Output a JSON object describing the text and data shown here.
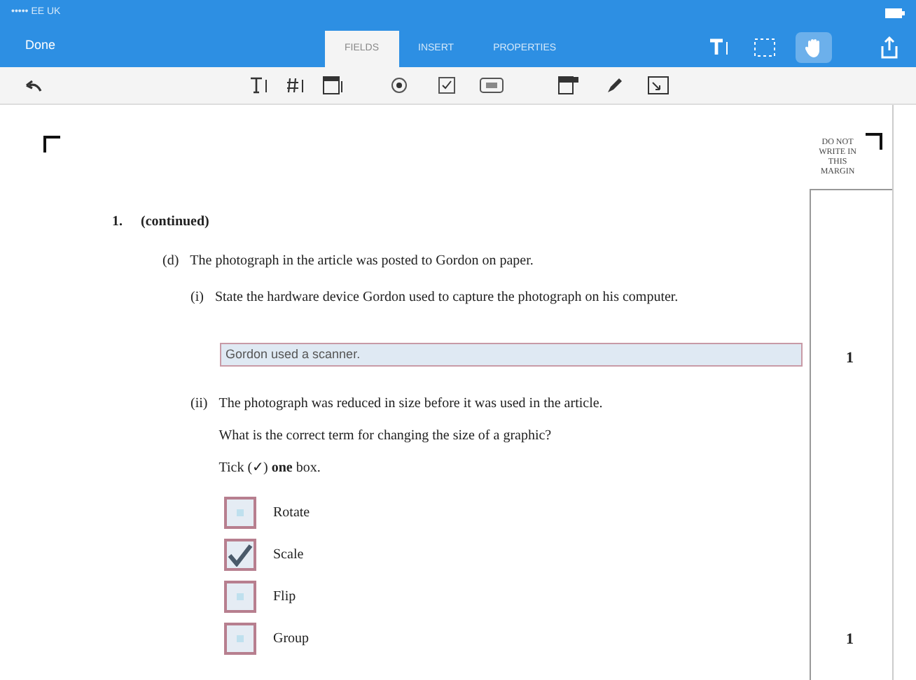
{
  "status_bar": {
    "carrier": "••••• EE UK"
  },
  "nav": {
    "done": "Done",
    "tabs": [
      {
        "label": "FIELDS",
        "selected": true
      },
      {
        "label": "INSERT",
        "selected": false
      },
      {
        "label": "PROPERTIES",
        "selected": false
      }
    ],
    "hand_tool": {
      "selected": true
    }
  },
  "document": {
    "margin_note": "DO NOT WRITE IN THIS MARGIN",
    "question_number": "1.",
    "heading": "(continued)",
    "part": {
      "label": "(d)",
      "text": "The photograph in the article was posted to Gordon on paper."
    },
    "sub_i": {
      "label": "(i)",
      "text": "State the hardware device Gordon used to capture the photograph on his computer.",
      "answer": "Gordon used a scanner.",
      "mark": "1"
    },
    "sub_ii": {
      "label": "(ii)",
      "lines": [
        "The photograph was reduced in size before it was used in the article.",
        "What is the correct term for changing the size of a graphic?",
        "Tick (✓) **one** box."
      ],
      "options": [
        {
          "label": "Rotate",
          "checked": false
        },
        {
          "label": "Scale",
          "checked": true
        },
        {
          "label": "Flip",
          "checked": false
        },
        {
          "label": "Group",
          "checked": false
        }
      ],
      "mark": "1"
    }
  }
}
